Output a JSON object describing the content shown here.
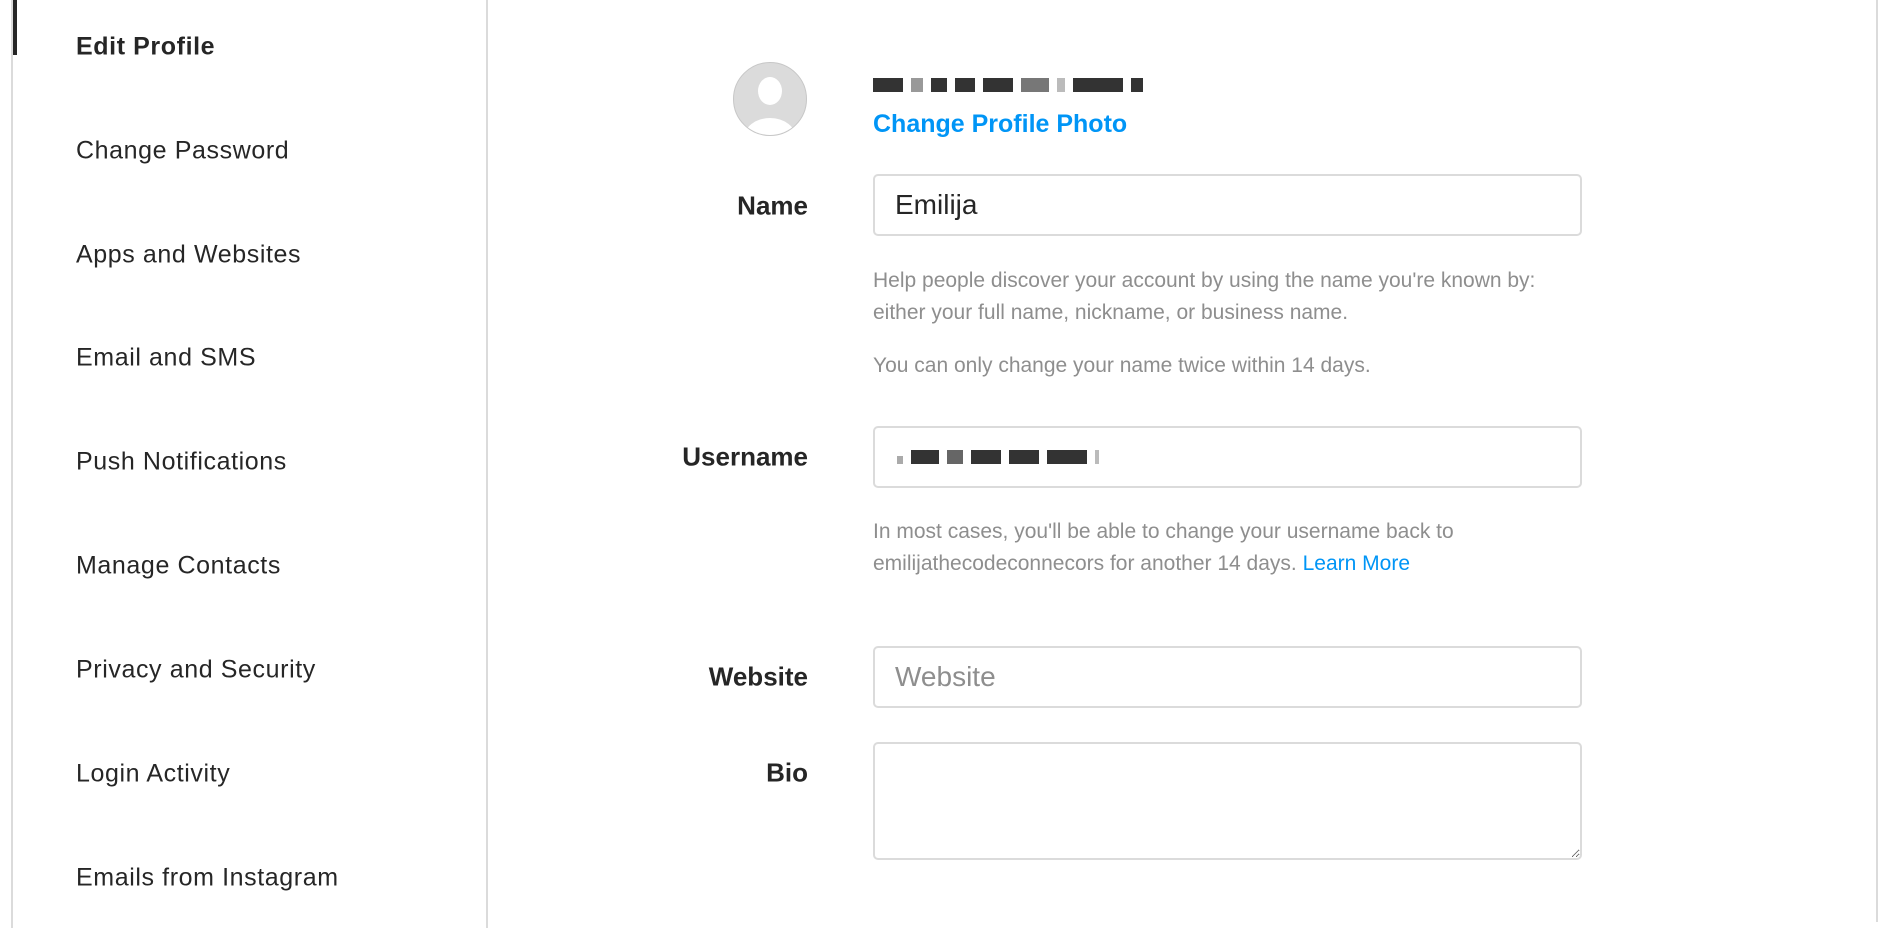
{
  "sidebar": {
    "items": [
      {
        "label": "Edit Profile",
        "active": true
      },
      {
        "label": "Change Password"
      },
      {
        "label": "Apps and Websites"
      },
      {
        "label": "Email and SMS"
      },
      {
        "label": "Push Notifications"
      },
      {
        "label": "Manage Contacts"
      },
      {
        "label": "Privacy and Security"
      },
      {
        "label": "Login Activity"
      },
      {
        "label": "Emails from Instagram"
      }
    ]
  },
  "profile": {
    "avatar_icon": "default-avatar-icon",
    "change_photo_label": "Change Profile Photo"
  },
  "form": {
    "name": {
      "label": "Name",
      "value": "Emilija",
      "help1": "Help people discover your account by using the name you're known by: either your full name, nickname, or business name.",
      "help2": "You can only change your name twice within 14 days."
    },
    "username": {
      "label": "Username",
      "help": "In most cases, you'll be able to change your username back to emilijathecodeconnecors for another 14 days.",
      "learn_more": "Learn More"
    },
    "website": {
      "label": "Website",
      "placeholder": "Website"
    },
    "bio": {
      "label": "Bio"
    }
  },
  "colors": {
    "accent": "#0095f6",
    "muted": "#8e8e8e",
    "border": "#dbdbdb"
  }
}
